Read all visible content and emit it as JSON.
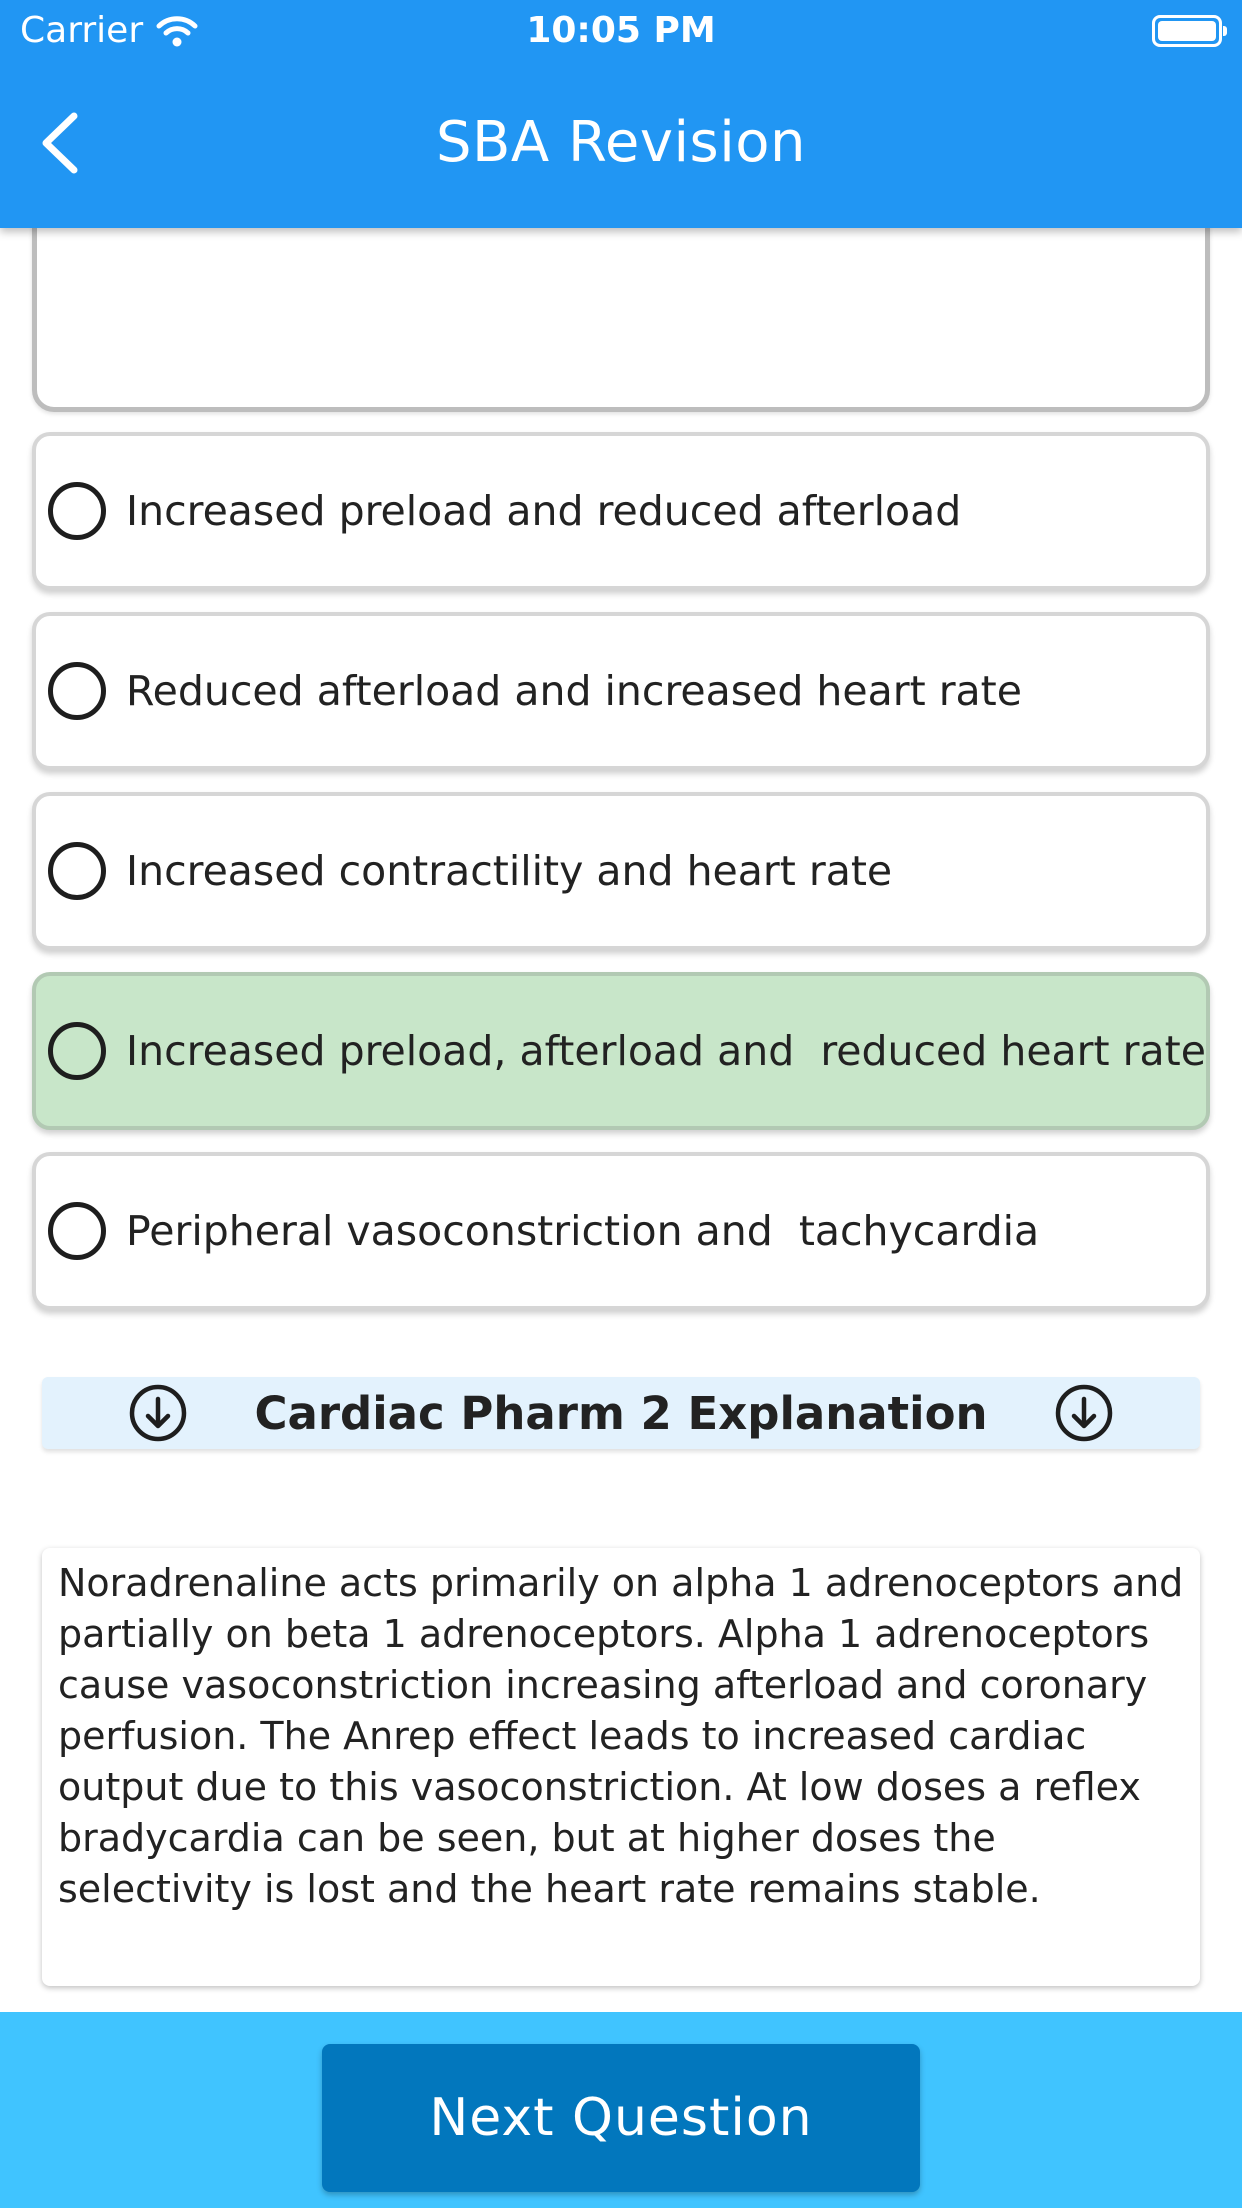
{
  "status_bar": {
    "carrier": "Carrier",
    "time": "10:05 PM"
  },
  "nav": {
    "title": "SBA Revision"
  },
  "options": [
    {
      "label": "Increased preload and reduced afterload",
      "correct": false
    },
    {
      "label": "Reduced afterload and increased heart rate",
      "correct": false
    },
    {
      "label": "Increased contractility and heart rate",
      "correct": false
    },
    {
      "label": "Increased preload, afterload and  reduced heart rate",
      "correct": true
    },
    {
      "label": "Peripheral vasoconstriction and  tachycardia",
      "correct": false
    }
  ],
  "explanation": {
    "title": "Cardiac Pharm 2 Explanation",
    "text": "Noradrenaline acts primarily on alpha 1 adrenoceptors and partially on beta 1 adrenoceptors. Alpha 1 adrenoceptors cause vasoconstriction increasing afterload and coronary perfusion. The Anrep effect leads to increased cardiac output due to this vasoconstriction. At low doses a reflex bradycardia can be seen, but at higher doses the selectivity is lost and the heart rate remains stable."
  },
  "footer": {
    "next_label": "Next Question"
  },
  "colors": {
    "header": "#2196f3",
    "correct_option": "#c8e6c9",
    "explanation_header": "#e3f2fd",
    "footer": "#40c4ff",
    "next_button": "#0277bd"
  },
  "icons": {
    "back": "chevron-left-icon",
    "wifi": "wifi-icon",
    "battery": "battery-icon",
    "expand": "arrow-down-circle-icon"
  }
}
